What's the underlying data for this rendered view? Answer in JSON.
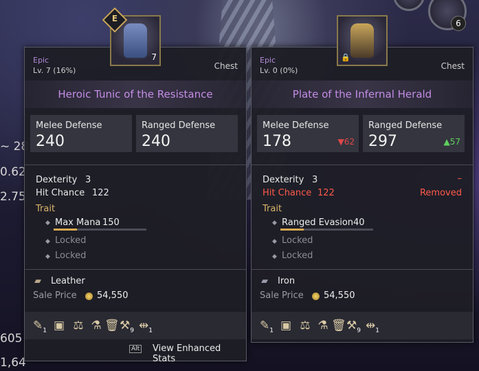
{
  "background": {
    "left_numbers": [
      "~ 28",
      "0.62",
      "2.75",
      "605",
      "1,64"
    ],
    "icon_count": "6"
  },
  "left_card": {
    "rarity": "Epic",
    "level": "Lv. 7 (16%)",
    "slot": "Chest",
    "name": "Heroic Tunic of the Resistance",
    "portrait_badge": "7",
    "portrait_grade": "E",
    "melee_label": "Melee Defense",
    "melee_value": "240",
    "ranged_label": "Ranged Defense",
    "ranged_value": "240",
    "stats": [
      {
        "label": "Dexterity",
        "value": "3"
      },
      {
        "label": "Hit Chance",
        "value": "122"
      }
    ],
    "trait_label": "Trait",
    "trait": {
      "name": "Max Mana",
      "value": "150",
      "progress": 0.25
    },
    "locked_1": "Locked",
    "locked_2": "Locked",
    "material": "Leather",
    "sale_label": "Sale Price",
    "sale_value": "54,550",
    "tool_count_a": "1",
    "tool_count_b": "9",
    "tool_count_c": "1",
    "alt_key": "Alt",
    "enhanced_label": "View Enhanced Stats"
  },
  "right_card": {
    "rarity": "Epic",
    "level": "Lv. 0 (0%)",
    "slot": "Chest",
    "name": "Plate of the Infernal Herald",
    "melee_label": "Melee Defense",
    "melee_value": "178",
    "melee_delta": "▼62",
    "ranged_label": "Ranged Defense",
    "ranged_value": "297",
    "ranged_delta": "▲57",
    "stats": [
      {
        "label": "Dexterity",
        "value": "3",
        "note": "–"
      },
      {
        "label": "Hit Chance",
        "value": "122",
        "note": "Removed"
      }
    ],
    "trait_label": "Trait",
    "trait": {
      "name": "Ranged Evasion",
      "value": "40",
      "progress": 0.25
    },
    "locked_1": "Locked",
    "locked_2": "Locked",
    "material": "Iron",
    "sale_label": "Sale Price",
    "sale_value": "54,550",
    "tool_count_a": "1",
    "tool_count_b": "9",
    "tool_count_c": "1"
  },
  "colors": {
    "epic": "#b48bd8",
    "item_name": "#c48de6",
    "decrease": "#e2474a",
    "increase": "#5fd35c",
    "removed": "#ff5a4a"
  }
}
